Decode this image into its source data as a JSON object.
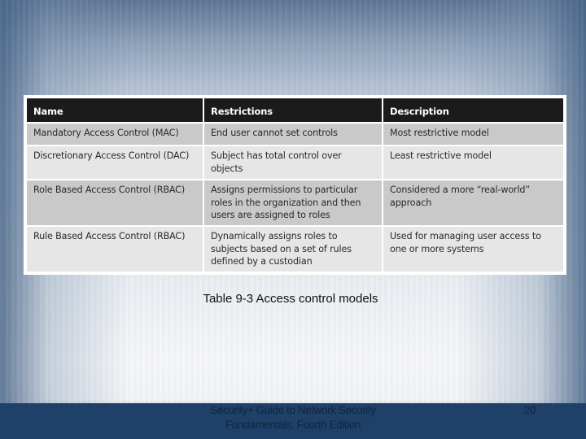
{
  "slide": {
    "caption": "Table 9-3 Access control models",
    "footer": {
      "title": "Security+ Guide to Network Security Fundamentals, Fourth Edition",
      "page_number": "20"
    },
    "colors": {
      "header_bg": "#1c1a1b",
      "row_shade": "#c9c9c9",
      "row_light": "#e6e6e6",
      "footer_bg": "#1f4068"
    }
  },
  "table": {
    "headers": [
      "Name",
      "Restrictions",
      "Description"
    ],
    "rows": [
      {
        "name": "Mandatory Access Control (MAC)",
        "restrictions": "End user cannot set controls",
        "description": "Most restrictive model"
      },
      {
        "name": "Discretionary Access Control (DAC)",
        "restrictions": "Subject has total control over objects",
        "description": "Least restrictive model"
      },
      {
        "name": "Role Based Access Control (RBAC)",
        "restrictions": "Assigns permissions to particular roles in the organization and then users are assigned to roles",
        "description": "Considered a more “real-world” approach"
      },
      {
        "name": "Rule Based Access Control (RBAC)",
        "restrictions": "Dynamically assigns roles to subjects based on a set of rules defined by a custodian",
        "description": "Used for managing user access to one or more systems"
      }
    ]
  }
}
